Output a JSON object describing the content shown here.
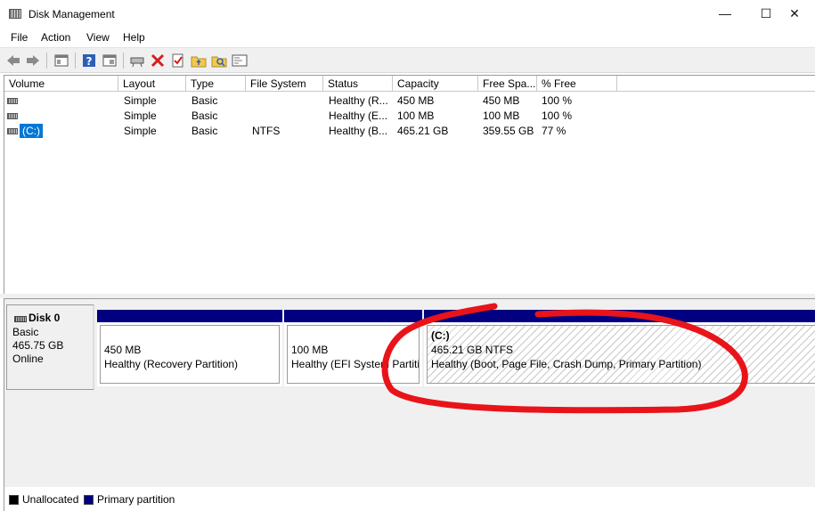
{
  "window": {
    "title": "Disk Management",
    "controls": {
      "minimize": "—",
      "maximize": "☐",
      "close": "✕"
    }
  },
  "menu": [
    "File",
    "Action",
    "View",
    "Help"
  ],
  "toolbar": {
    "icons": [
      "back-arrow-icon",
      "forward-arrow-icon",
      "console-tree-icon",
      "help-icon",
      "console-icon",
      "connect-drive-icon",
      "delete-icon",
      "check-icon",
      "folder-up-icon",
      "search-icon",
      "properties-icon"
    ]
  },
  "volume_list": {
    "columns": [
      "Volume",
      "Layout",
      "Type",
      "File System",
      "Status",
      "Capacity",
      "Free Spa...",
      "% Free"
    ],
    "rows": [
      {
        "volume": "",
        "layout": "Simple",
        "type": "Basic",
        "fs": "",
        "status": "Healthy (R...",
        "capacity": "450 MB",
        "free": "450 MB",
        "pct": "100 %"
      },
      {
        "volume": "",
        "layout": "Simple",
        "type": "Basic",
        "fs": "",
        "status": "Healthy (E...",
        "capacity": "100 MB",
        "free": "100 MB",
        "pct": "100 %"
      },
      {
        "volume": "(C:)",
        "layout": "Simple",
        "type": "Basic",
        "fs": "NTFS",
        "status": "Healthy (B...",
        "capacity": "465.21 GB",
        "free": "359.55 GB",
        "pct": "77 %"
      }
    ]
  },
  "disk": {
    "name": "Disk 0",
    "type": "Basic",
    "size": "465.75 GB",
    "state": "Online",
    "partitions": [
      {
        "name": "",
        "size": "450 MB",
        "status": "Healthy (Recovery Partition)"
      },
      {
        "name": "",
        "size": "100 MB",
        "status": "Healthy (EFI System Partitic"
      },
      {
        "name": "(C:)",
        "size": "465.21 GB NTFS",
        "status": "Healthy (Boot, Page File, Crash Dump, Primary Partition)"
      }
    ]
  },
  "legend": [
    {
      "label": "Unallocated",
      "color": "#000000"
    },
    {
      "label": "Primary partition",
      "color": "#000080"
    }
  ],
  "colors": {
    "partition_bar": "#000080",
    "selection": "#0078d7",
    "annotation": "#e8141a"
  }
}
